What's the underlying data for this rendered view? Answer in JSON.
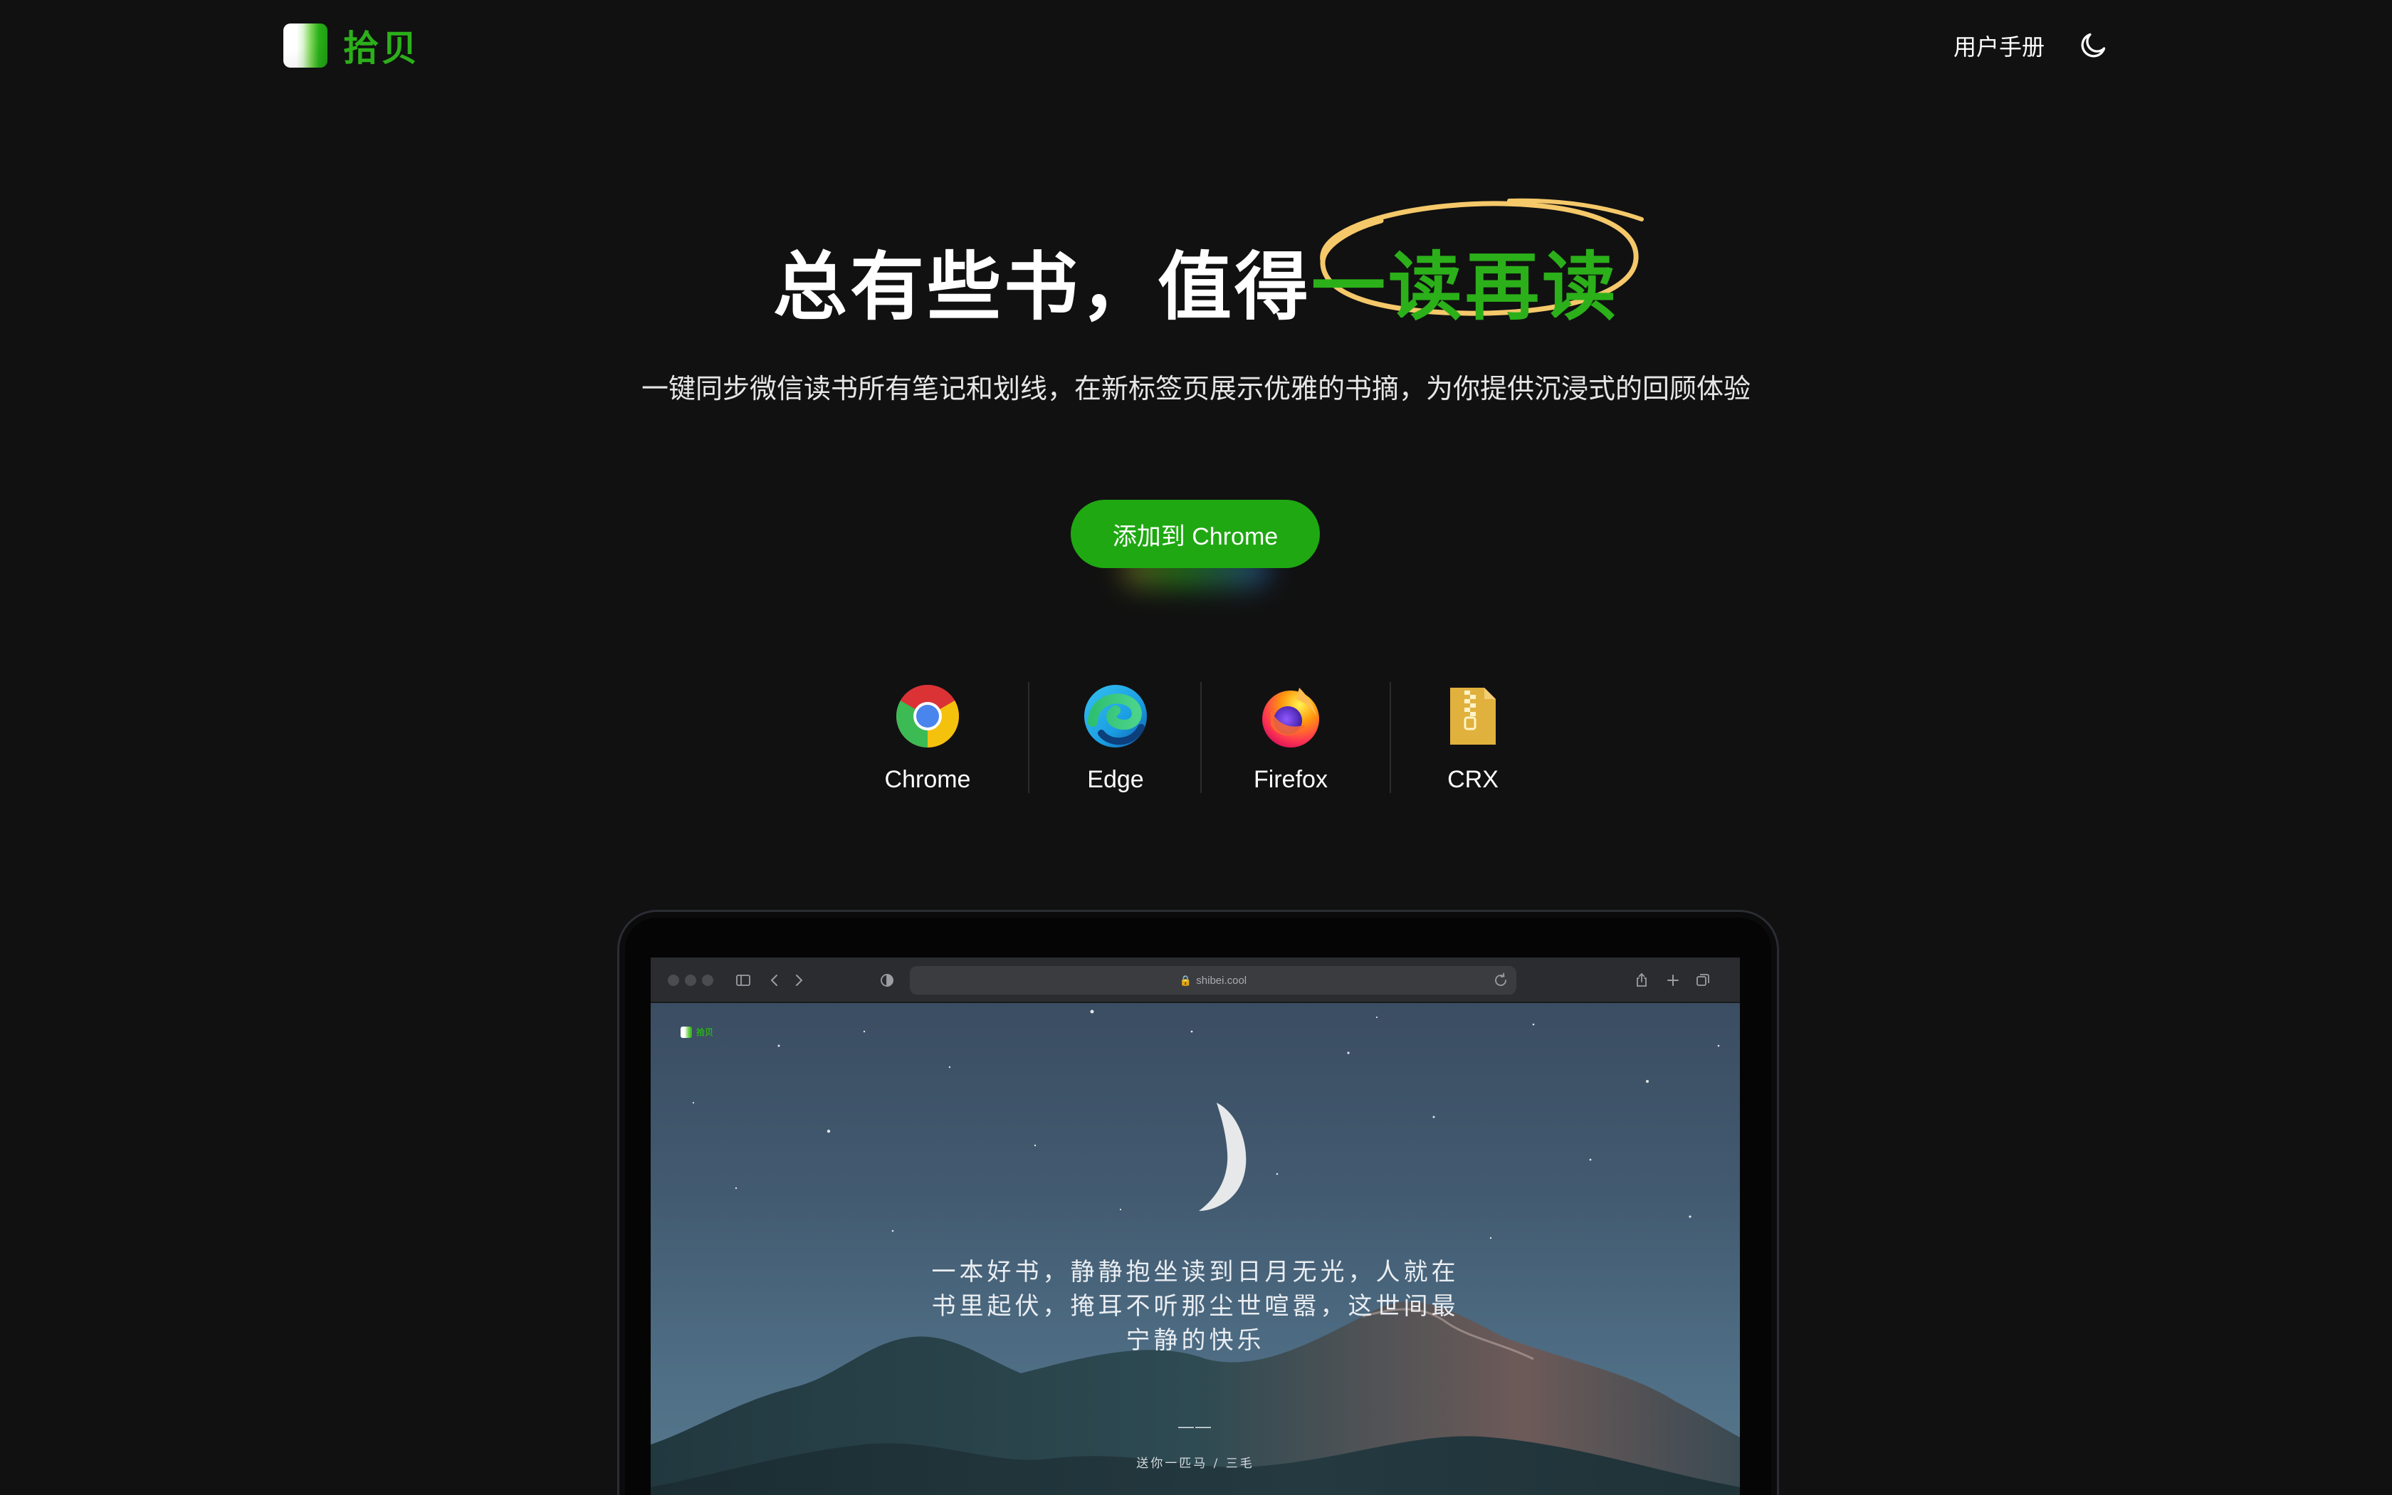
{
  "header": {
    "logo_text": "拾贝",
    "manual_link": "用户手册",
    "theme_toggle_icon": "moon-icon"
  },
  "hero": {
    "title_lead": "总有些书，值得",
    "title_highlight": "一读再读",
    "highlight_color": "#2bb01a",
    "circle_color": "#f5c86a",
    "subtitle": "一键同步微信读书所有笔记和划线，在新标签页展示优雅的书摘，为你提供沉浸式的回顾体验",
    "cta_label": "添加到 Chrome"
  },
  "browsers": [
    {
      "label": "Chrome",
      "icon": "chrome-icon"
    },
    {
      "label": "Edge",
      "icon": "edge-icon"
    },
    {
      "label": "Firefox",
      "icon": "firefox-icon"
    },
    {
      "label": "CRX",
      "icon": "zip-file-icon"
    }
  ],
  "preview": {
    "url": "shibei.cool",
    "mini_logo_text": "拾贝",
    "quote_lines": [
      "一本好书，静静抱坐读到日月无光，人就在",
      "书里起伏，掩耳不听那尘世喧嚣，这世间最",
      "宁静的快乐"
    ],
    "quote_dash": "——",
    "quote_source": "送你一匹马 / 三毛"
  },
  "colors": {
    "background": "#111111",
    "accent": "#2bb01a"
  }
}
